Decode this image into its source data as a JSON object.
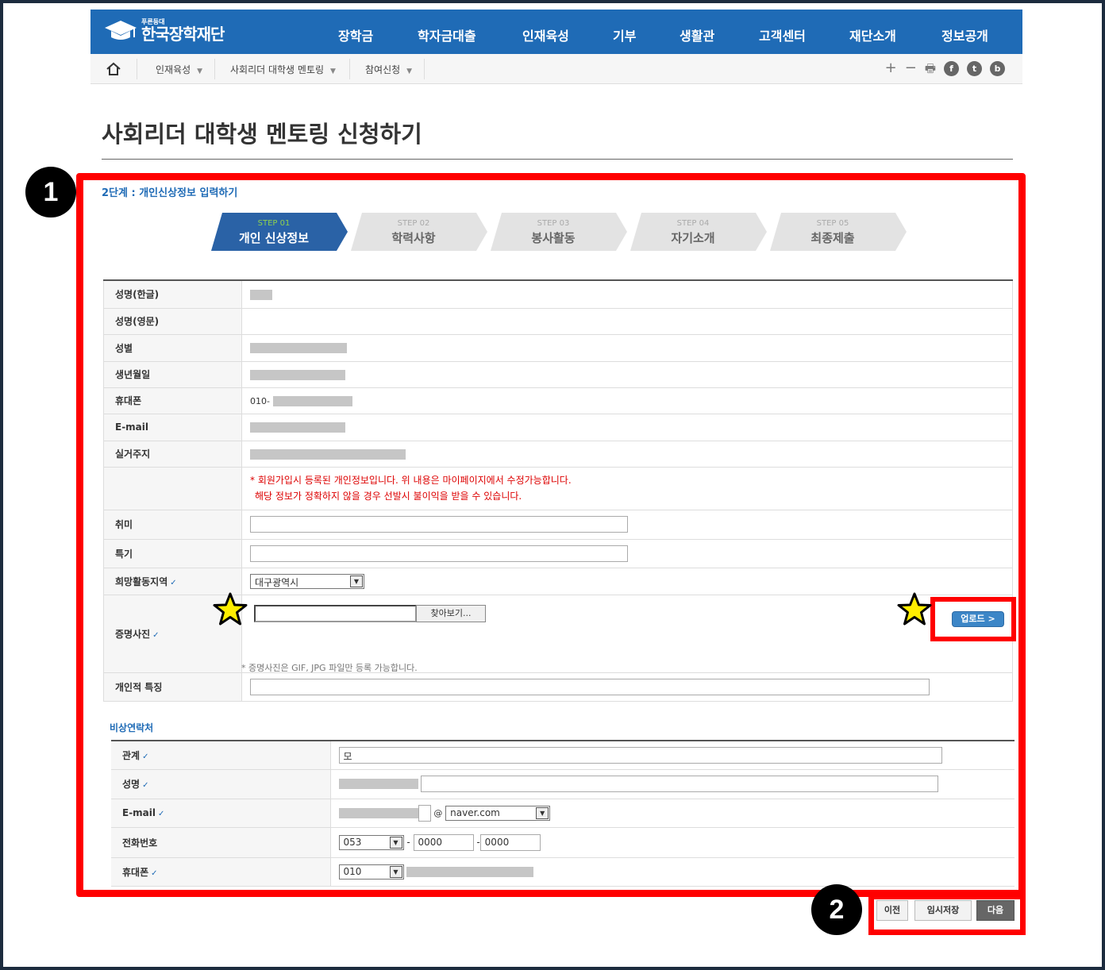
{
  "header": {
    "logo_small": "푸른등대",
    "logo_main": "한국장학재단",
    "menu": [
      "장학금",
      "학자금대출",
      "인재육성",
      "기부",
      "생활관",
      "고객센터",
      "재단소개",
      "정보공개"
    ]
  },
  "breadcrumb": {
    "items": [
      "인재육성",
      "사회리더 대학생 멘토링",
      "참여신청"
    ],
    "tools": [
      "+",
      "−",
      "🖶",
      "f",
      "t",
      "b"
    ]
  },
  "page": {
    "title": "사회리더 대학생 멘토링 신청하기",
    "stage": "2단계 : 개인신상정보 입력하기"
  },
  "steps": [
    {
      "num": "STEP 01",
      "label": "개인 신상정보",
      "active": true
    },
    {
      "num": "STEP 02",
      "label": "학력사항",
      "active": false
    },
    {
      "num": "STEP 03",
      "label": "봉사활동",
      "active": false
    },
    {
      "num": "STEP 04",
      "label": "자기소개",
      "active": false
    },
    {
      "num": "STEP 05",
      "label": "최종제출",
      "active": false
    }
  ],
  "personal": {
    "labels": {
      "name_kr": "성명(한글)",
      "name_en": "성명(영문)",
      "gender": "성별",
      "birth": "생년월일",
      "mobile": "휴대폰",
      "email": "E-mail",
      "address": "실거주지",
      "hobby": "취미",
      "skill": "특기",
      "region": "희망활동지역",
      "photo": "증명사진",
      "personal_trait": "개인적 특징"
    },
    "mobile_prefix": "010-",
    "notice_1": "* 회원가입시 등록된 개인정보입니다. 위 내용은 마이페이지에서 수정가능합니다.",
    "notice_2": "해당 정보가 정확하지 않을 경우 선발시 불이익을 받을 수 있습니다.",
    "region_value": "대구광역시",
    "browse_label": "찾아보기...",
    "upload_label": "업로드 >",
    "photo_note": "* 증명사진은 GIF, JPG 파일만 등록 가능합니다."
  },
  "emergency": {
    "title": "비상연락처",
    "labels": {
      "relation": "관계",
      "name": "성명",
      "email": "E-mail",
      "phone": "전화번호",
      "mobile": "휴대폰"
    },
    "relation_value": "모",
    "email_at": "@",
    "email_domain": "naver.com",
    "phone_area": "053",
    "phone_mid": "0000",
    "phone_last": "0000",
    "phone_dash": "-",
    "mobile_prefix": "010"
  },
  "buttons": {
    "prev": "이전",
    "temp_save": "임시저장",
    "next": "다음"
  },
  "annotations": {
    "badge_1": "1",
    "badge_2": "2"
  },
  "colors": {
    "brand_blue": "#1f6bb6",
    "highlight_red": "#ff0000",
    "star_yellow": "#ffee00"
  }
}
